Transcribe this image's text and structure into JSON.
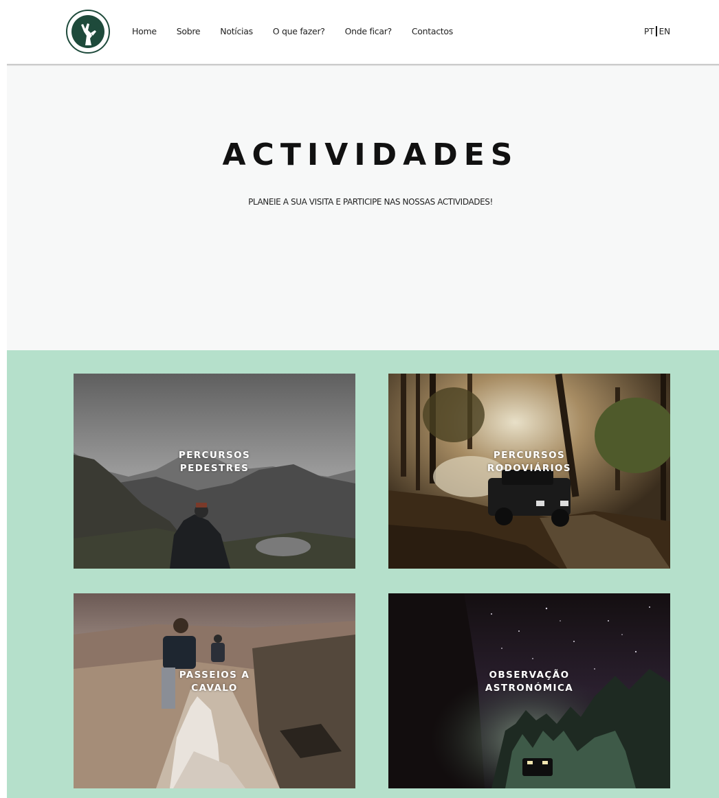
{
  "header": {
    "logo_icon": "deer-emblem-logo",
    "nav": [
      {
        "label": "Home"
      },
      {
        "label": "Sobre"
      },
      {
        "label": "Notícias"
      },
      {
        "label": "O que fazer?"
      },
      {
        "label": "Onde ficar?"
      },
      {
        "label": "Contactos"
      }
    ],
    "languages": {
      "current": "PT",
      "other": "EN"
    }
  },
  "hero": {
    "title": "ACTIVIDADES",
    "subtitle": "PLANEIE A SUA VISITA E PARTICIPE NAS NOSSAS ACTIVIDADES!"
  },
  "activities": {
    "background_color": "#b5e0cb",
    "cards": [
      {
        "label": "PERCURSOS\nPEDESTRES"
      },
      {
        "label": "PERCURSOS\nRODOVIÁRIOS"
      },
      {
        "label": "PASSEIOS A\nCAVALO"
      },
      {
        "label": "OBSERVAÇÃO\nASTRONÓMICA"
      }
    ]
  },
  "colors": {
    "brand_green": "#1e4a3b",
    "accent_mint": "#b5e0cb"
  }
}
